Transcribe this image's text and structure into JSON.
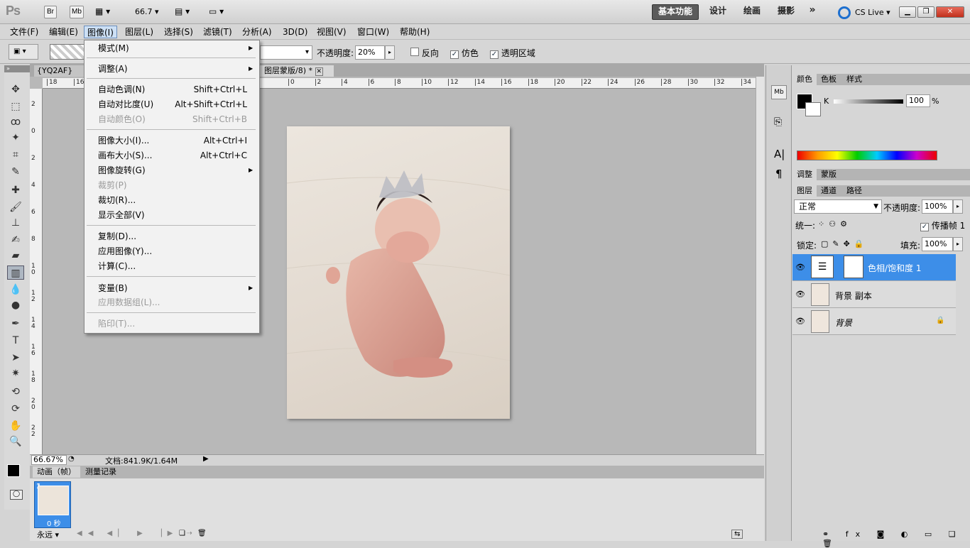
{
  "appbar": {
    "logo": "Ps",
    "br": "Br",
    "mb": "Mb",
    "zoom": "66.7",
    "workspaces": [
      "基本功能",
      "设计",
      "绘画",
      "摄影"
    ],
    "more": "»",
    "cslive": "CS Live"
  },
  "menubar": [
    "文件(F)",
    "编辑(E)",
    "图像(I)",
    "图层(L)",
    "选择(S)",
    "滤镜(T)",
    "分析(A)",
    "3D(D)",
    "视图(V)",
    "窗口(W)",
    "帮助(H)"
  ],
  "options": {
    "opacity_label": "不透明度:",
    "opacity_value": "20%",
    "reverse": "反向",
    "dither": "仿色",
    "transparency": "透明区域"
  },
  "tabs": {
    "doc1": "{YQ2AF}[TTC",
    "doc2": "图层蒙版/8) *"
  },
  "ruler_h": [
    "18",
    "16",
    "0",
    "2",
    "4",
    "6",
    "8",
    "10",
    "12",
    "14",
    "16",
    "18",
    "20",
    "22",
    "24",
    "26",
    "28",
    "30",
    "32",
    "34"
  ],
  "ruler_v": [
    "2",
    "0",
    "2",
    "4",
    "6",
    "8",
    "1 0",
    "1 2",
    "1 4",
    "1 6",
    "1 8",
    "2 0",
    "2 2"
  ],
  "status": {
    "zoom": "66.67%",
    "doc": "文档:841.9K/1.64M"
  },
  "anim": {
    "tab1": "动画（帧）",
    "tab2": "测量记录",
    "frame_num": "1",
    "frame_time": "0 秒",
    "loop": "永远"
  },
  "dropdown": {
    "items": [
      {
        "label": "模式(M)",
        "shortcut": "",
        "disabled": false,
        "submenu": true
      },
      {
        "label": "调整(A)",
        "shortcut": "",
        "disabled": false,
        "submenu": true
      },
      {
        "label": "自动色调(N)",
        "shortcut": "Shift+Ctrl+L",
        "disabled": false
      },
      {
        "label": "自动对比度(U)",
        "shortcut": "Alt+Shift+Ctrl+L",
        "disabled": false
      },
      {
        "label": "自动颜色(O)",
        "shortcut": "Shift+Ctrl+B",
        "disabled": true
      },
      {
        "label": "图像大小(I)...",
        "shortcut": "Alt+Ctrl+I",
        "disabled": false
      },
      {
        "label": "画布大小(S)...",
        "shortcut": "Alt+Ctrl+C",
        "disabled": false
      },
      {
        "label": "图像旋转(G)",
        "shortcut": "",
        "disabled": false,
        "submenu": true
      },
      {
        "label": "裁剪(P)",
        "shortcut": "",
        "disabled": true
      },
      {
        "label": "裁切(R)...",
        "shortcut": "",
        "disabled": false
      },
      {
        "label": "显示全部(V)",
        "shortcut": "",
        "disabled": false
      },
      {
        "label": "复制(D)...",
        "shortcut": "",
        "disabled": false
      },
      {
        "label": "应用图像(Y)...",
        "shortcut": "",
        "disabled": false
      },
      {
        "label": "计算(C)...",
        "shortcut": "",
        "disabled": false
      },
      {
        "label": "变量(B)",
        "shortcut": "",
        "disabled": false,
        "submenu": true
      },
      {
        "label": "应用数据组(L)...",
        "shortcut": "",
        "disabled": true
      },
      {
        "label": "陷印(T)...",
        "shortcut": "",
        "disabled": true
      }
    ]
  },
  "color_panel": {
    "tabs": [
      "颜色",
      "色板",
      "样式"
    ],
    "k_label": "K",
    "k_value": "100",
    "percent": "%"
  },
  "adjust_panel": {
    "tabs": [
      "调整",
      "蒙版"
    ]
  },
  "layers_panel": {
    "tabs": [
      "图层",
      "通道",
      "路径"
    ],
    "blend": "正常",
    "opacity_label": "不透明度:",
    "opacity": "100%",
    "unify": "统一:",
    "propagate": "传播帧 1",
    "lock": "锁定:",
    "fill_label": "填充:",
    "fill": "100%",
    "layers": [
      "色相/饱和度 1",
      "背景 副本",
      "背景"
    ]
  },
  "colors": {
    "accent": "#3d8ee8",
    "menu_hover": "#cde0f5"
  }
}
